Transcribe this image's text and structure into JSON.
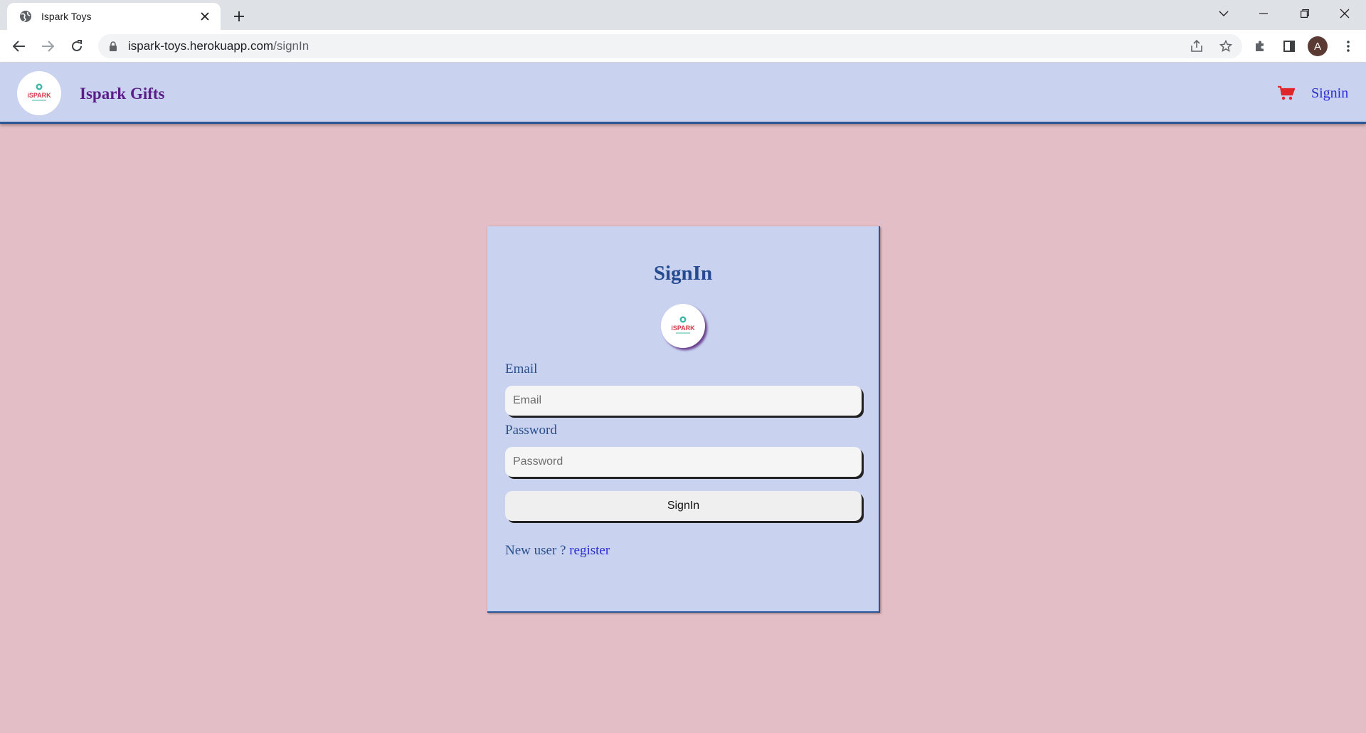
{
  "browser": {
    "tab_title": "Ispark Toys",
    "url_host": "ispark-toys.herokuapp.com",
    "url_path": "/signIn",
    "profile_initial": "A"
  },
  "header": {
    "brand": "Ispark Gifts",
    "logo_text": "iSPARK",
    "signin_link": "Signin",
    "cart_color": "#e0262b"
  },
  "signin_form": {
    "title": "SignIn",
    "email_label": "Email",
    "email_placeholder": "Email",
    "password_label": "Password",
    "password_placeholder": "Password",
    "submit_label": "SignIn",
    "new_user_text": "New user ?",
    "register_link": "register"
  },
  "colors": {
    "page_background": "#e4bec6",
    "header_background": "#c9d3f0",
    "accent_border": "#2a5597",
    "brand_text": "#5b1e88",
    "link": "#2b2bd6"
  }
}
